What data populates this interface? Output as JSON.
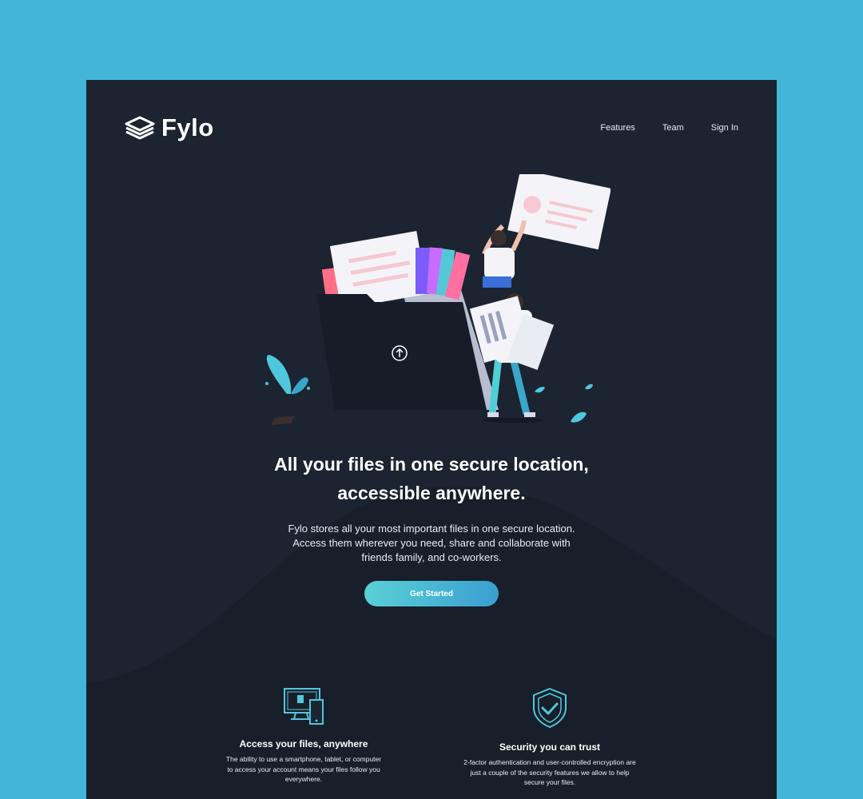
{
  "brand": {
    "name": "Fylo"
  },
  "nav": {
    "features": "Features",
    "team": "Team",
    "sign_in": "Sign In"
  },
  "hero": {
    "title_line1": "All your files in one secure location,",
    "title_line2": "accessible anywhere.",
    "desc_line1": "Fylo stores all your most important files in one secure location.",
    "desc_line2": "Access them wherever you need, share and collaborate with",
    "desc_line3": "friends family, and co-workers.",
    "cta": "Get Started"
  },
  "features": [
    {
      "icon": "devices-icon",
      "title": "Access your files, anywhere",
      "desc_line1": "The ability to use a smartphone, tablet, or computer",
      "desc_line2": "to access your account means your files follow you",
      "desc_line3": "everywhere."
    },
    {
      "icon": "shield-check-icon",
      "title": "Security you can trust",
      "desc_line1": "2-factor authentication and user-controlled encryption are",
      "desc_line2": "just a couple of the security features we allow to help",
      "desc_line3": "secure your files."
    }
  ],
  "colors": {
    "page_bg": "#43b5d8",
    "panel_bg": "#1c2331",
    "wave_bg": "#181f2a",
    "accent_cyan": "#5ad0d6",
    "accent_blue": "#3a9fd0",
    "text": "#ffffff"
  }
}
